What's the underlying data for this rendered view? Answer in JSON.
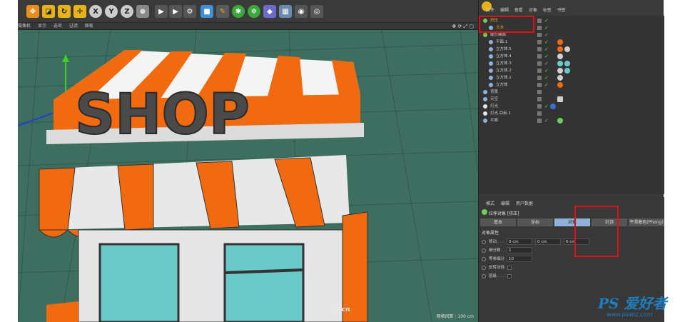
{
  "toolbar": {
    "axis_x": "X",
    "axis_y": "Y",
    "axis_z": "Z"
  },
  "viewport_menu": [
    "摄像机",
    "显示",
    "选项",
    "过滤",
    "面板"
  ],
  "viewport_icons": "✥ ⟳ ⤢ ▢",
  "viewport": {
    "scene_text": "SHOP",
    "grid_label": "网格间距 : 100 cm",
    "ui_watermark": "Ui·cn"
  },
  "object_panel": {
    "menu": [
      "文件",
      "编辑",
      "查看",
      "对象",
      "标签",
      "书签"
    ],
    "objects": [
      {
        "name": "挤压",
        "color": "#e6a21e",
        "indent": 0
      },
      {
        "name": "文本",
        "color": "#e6a21e",
        "indent": 1
      },
      {
        "name": "细分曲面",
        "color": "#6ccf5a",
        "indent": 0
      },
      {
        "name": "平面.1",
        "color": "#8fb2d8",
        "indent": 1
      },
      {
        "name": "立方体.5",
        "color": "#8fb2d8",
        "indent": 1
      },
      {
        "name": "立方体.4",
        "color": "#8fb2d8",
        "indent": 1
      },
      {
        "name": "立方体.3",
        "color": "#8fb2d8",
        "indent": 1
      },
      {
        "name": "立方体.2",
        "color": "#8fb2d8",
        "indent": 1
      },
      {
        "name": "立方体.1",
        "color": "#8fb2d8",
        "indent": 1
      },
      {
        "name": "立方体",
        "color": "#8fb2d8",
        "indent": 1
      },
      {
        "name": "背景",
        "color": "#8fb2d8",
        "indent": 0
      },
      {
        "name": "天空",
        "color": "#8fb2d8",
        "indent": 0
      },
      {
        "name": "灯光",
        "color": "#e6e6e6",
        "indent": 0
      },
      {
        "name": "灯光.目标.1",
        "color": "#e6e6e6",
        "indent": 0
      },
      {
        "name": "平面",
        "color": "#8fb2d8",
        "indent": 0
      }
    ]
  },
  "attributes": {
    "menu": [
      "模式",
      "编辑",
      "用户数据"
    ],
    "title": "拉伸对象 [挤压]",
    "tabs": [
      "基本",
      "坐标",
      "对象",
      "封顶",
      "平滑着色(Phong)"
    ],
    "section": "对象属性",
    "move_label": "移动 . . .",
    "move_x": "0 cm",
    "move_y": "0 cm",
    "move_z": "6 cm",
    "subdiv_label": "细分数 . .",
    "subdiv_value": "1",
    "iso_label": "等参细分",
    "iso_value": "10",
    "flip_label": "反转法线",
    "layer_label": "层级 . . . ."
  },
  "watermark": {
    "ps": "PS 爱好者",
    "site": "www.psahz.com"
  },
  "colors": {
    "accent_red": "#e01010",
    "tab_active": "#8fb2d8",
    "grid_bg": "#3d6e60",
    "orange": "#f26a10"
  }
}
